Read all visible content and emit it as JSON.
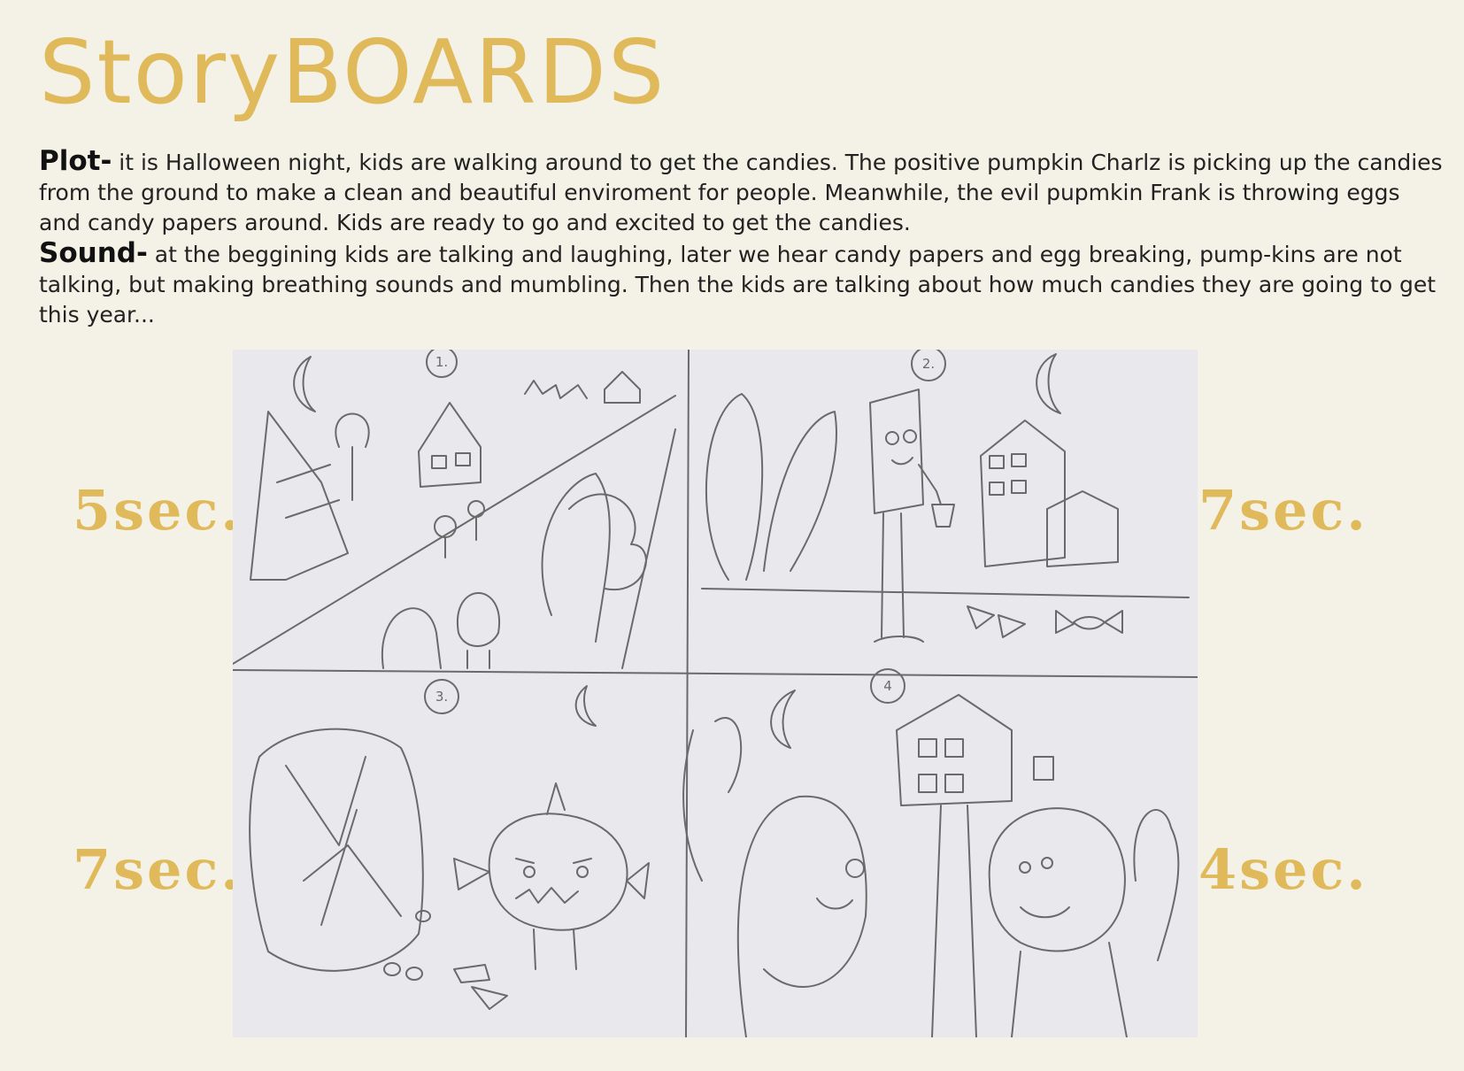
{
  "page": {
    "title": "StoryBOARDS"
  },
  "plot": {
    "label": "Plot-",
    "text": " it is Halloween night, kids are walking around to get the candies. The positive pumpkin Charlz is picking up the candies from the ground to make a clean and beautiful enviroment for people. Meanwhile, the evil pupmkin Frank is  throwing eggs and candy papers around. Kids are ready to go and excited to get the candies."
  },
  "sound": {
    "label": "Sound-",
    "text": " at  the beggining kids are talking and laughing, later we hear candy papers and egg breaking, pump-kins are not talking, but making breathing sounds and mumbling. Then the kids are talking about how much candies they are going to get this year..."
  },
  "durations": [
    "5sec.",
    "7sec.",
    "7sec.",
    "4sec."
  ],
  "panel_numbers": [
    "1.",
    "2.",
    "3.",
    "4"
  ],
  "colors": {
    "accent": "#e0ba5a",
    "background": "#f4f2e6",
    "paper": "#e9e8ec",
    "pencil": "#6a6a6a"
  }
}
